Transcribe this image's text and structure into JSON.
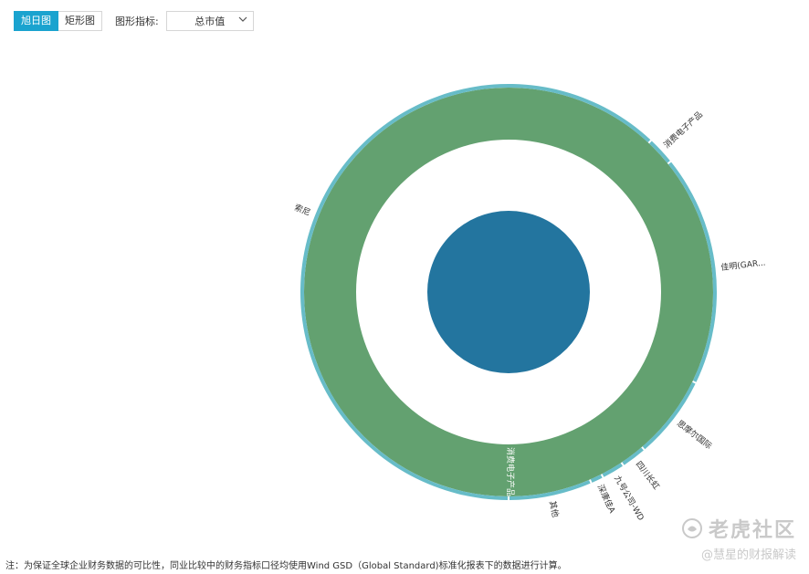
{
  "toolbar": {
    "tabs": [
      {
        "label": "旭日图",
        "active": true
      },
      {
        "label": "矩形图",
        "active": false
      }
    ],
    "indicator_label": "图形指标:",
    "indicator_value": "总市值",
    "chevron_icon": "chevron-down-icon"
  },
  "chart_data": {
    "type": "sunburst",
    "center": {
      "color": "#23759f"
    },
    "inner_ring": {
      "name": "消费电子产品",
      "value": 1,
      "color": "#63a170"
    },
    "outer_ring": [
      {
        "name": "索尼",
        "value": 62.0
      },
      {
        "name": "消费电子产品",
        "value": 2.2
      },
      {
        "name": "佳明(GAR...",
        "value": 18.0
      },
      {
        "name": "思摩尔国际",
        "value": 6.5
      },
      {
        "name": "四川长虹",
        "value": 2.0
      },
      {
        "name": "九号公司-WD",
        "value": 1.8
      },
      {
        "name": "深康佳A",
        "value": 1.0
      },
      {
        "name": "其他",
        "value": 6.5
      }
    ],
    "outer_ring_color": "#67bcc8"
  },
  "footnote": "注：为保证全球企业财务数据的可比性，同业比较中的财务指标口径均使用Wind GSD（Global Standard)标准化报表下的数据进行计算。",
  "watermark": {
    "brand": "老虎社区",
    "sub": "@慧星的财报解读"
  }
}
